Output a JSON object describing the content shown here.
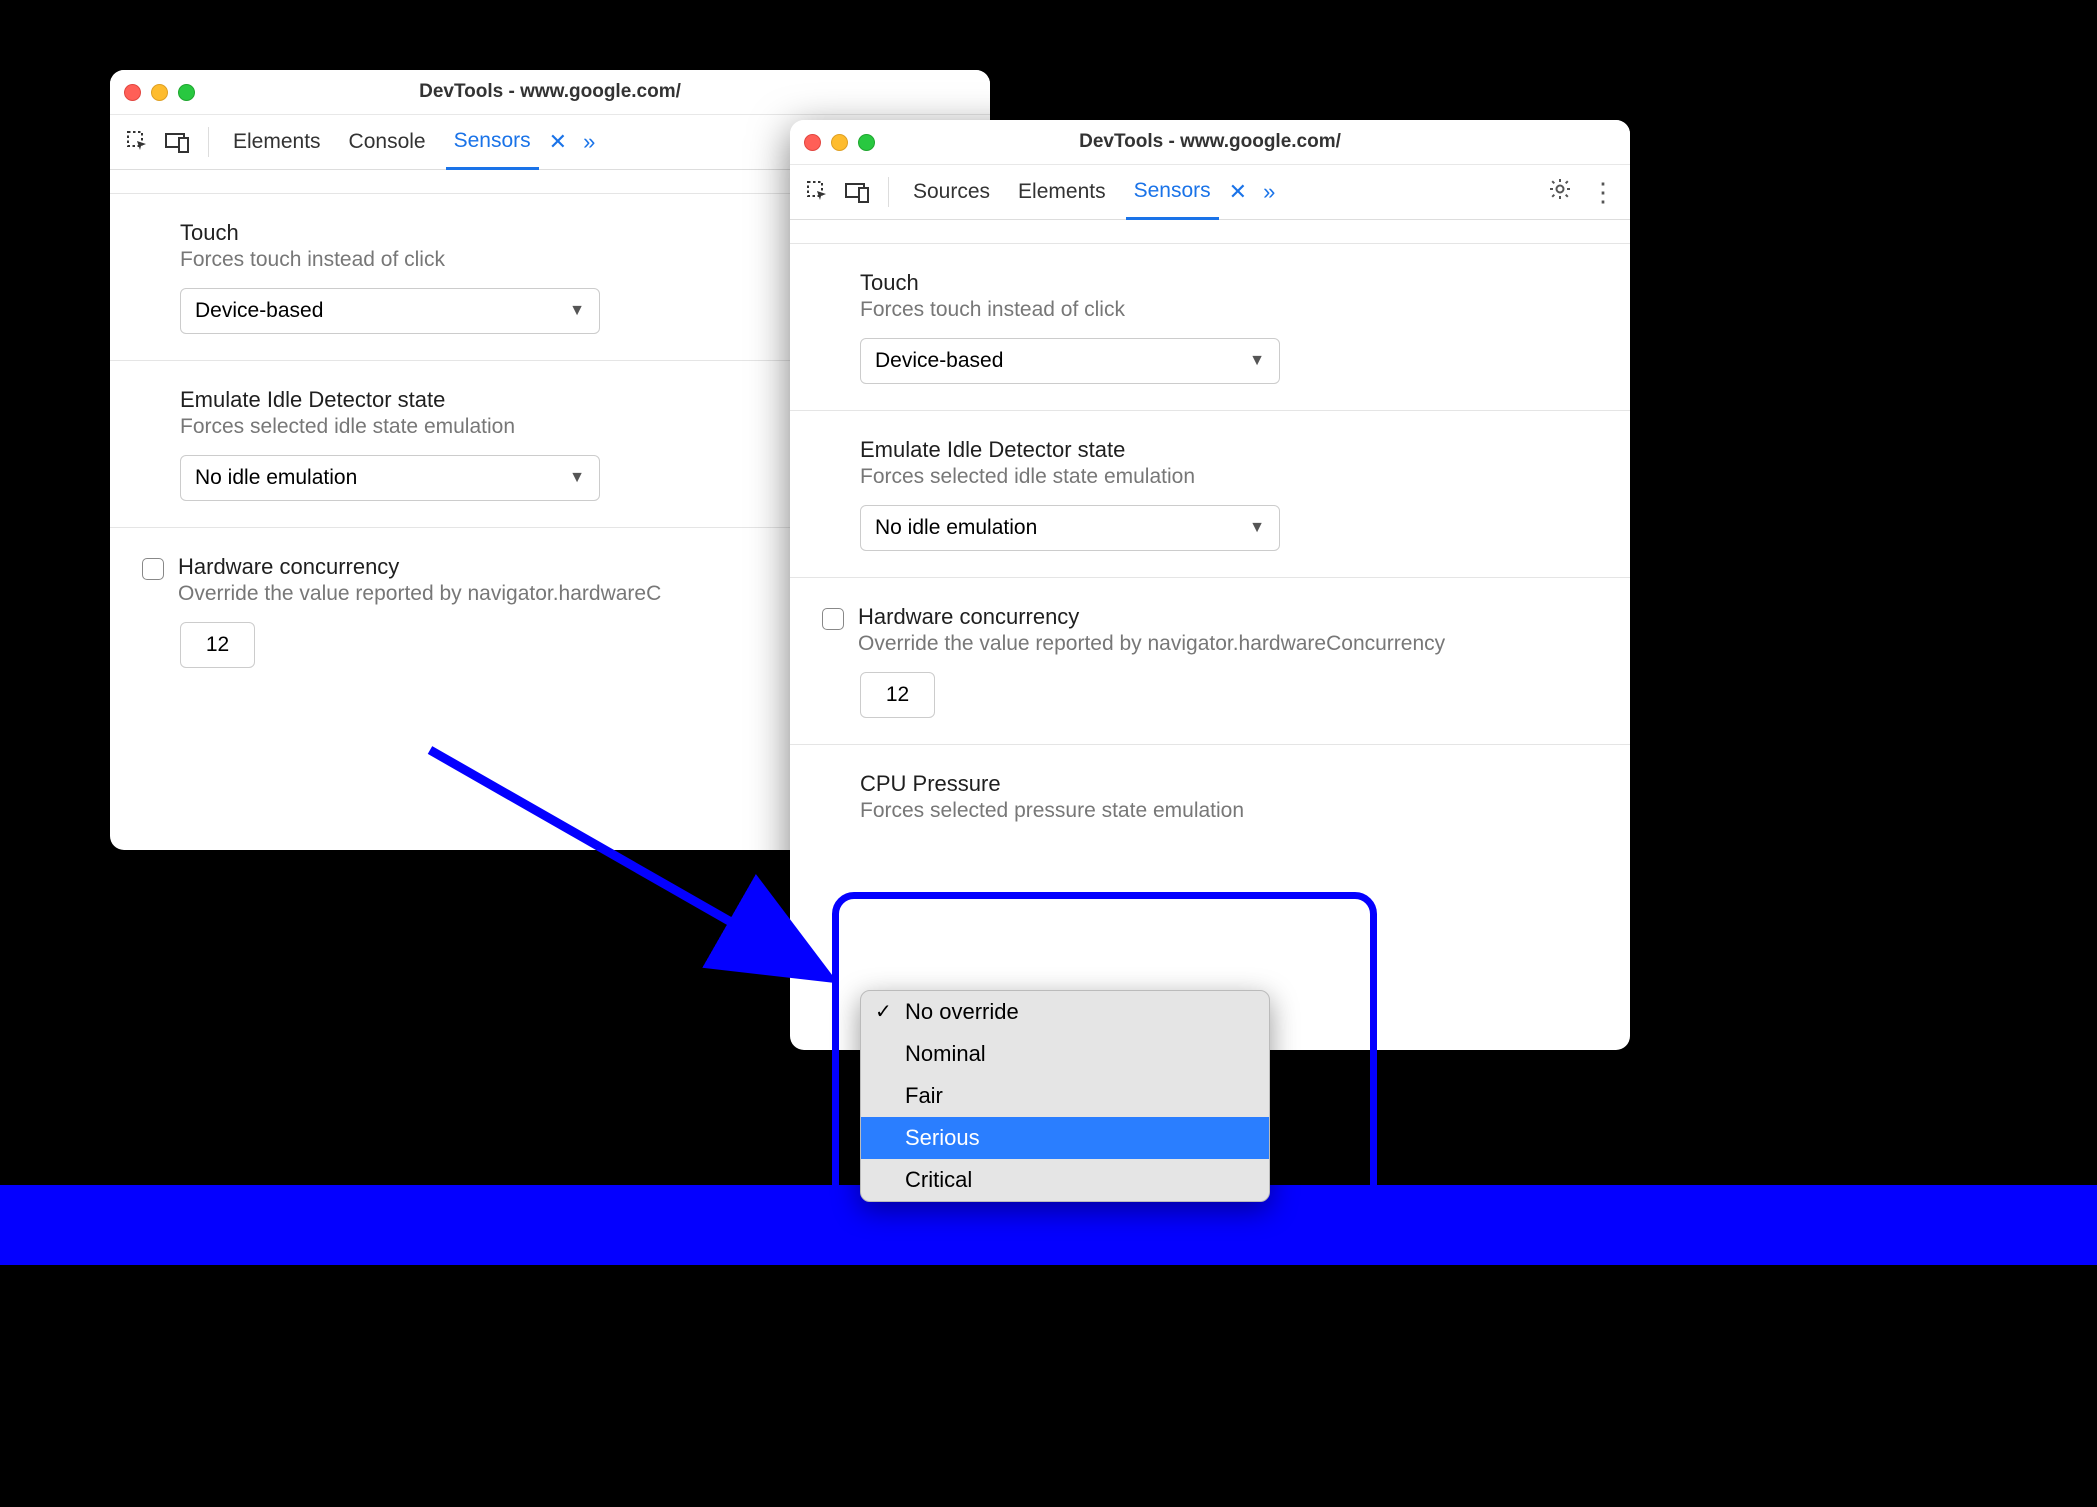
{
  "window_left": {
    "title": "DevTools - www.google.com/",
    "tabs": [
      "Elements",
      "Console",
      "Sensors"
    ],
    "active_tab": "Sensors",
    "touch": {
      "label": "Touch",
      "desc": "Forces touch instead of click",
      "value": "Device-based"
    },
    "idle": {
      "label": "Emulate Idle Detector state",
      "desc": "Forces selected idle state emulation",
      "value": "No idle emulation"
    },
    "hw": {
      "label": "Hardware concurrency",
      "desc": "Override the value reported by navigator.hardwareC",
      "value": "12"
    }
  },
  "window_right": {
    "title": "DevTools - www.google.com/",
    "tabs": [
      "Sources",
      "Elements",
      "Sensors"
    ],
    "active_tab": "Sensors",
    "touch": {
      "label": "Touch",
      "desc": "Forces touch instead of click",
      "value": "Device-based"
    },
    "idle": {
      "label": "Emulate Idle Detector state",
      "desc": "Forces selected idle state emulation",
      "value": "No idle emulation"
    },
    "hw": {
      "label": "Hardware concurrency",
      "desc": "Override the value reported by navigator.hardwareConcurrency",
      "value": "12"
    },
    "pressure": {
      "label": "CPU Pressure",
      "desc": "Forces selected pressure state emulation",
      "options": [
        "No override",
        "Nominal",
        "Fair",
        "Serious",
        "Critical"
      ],
      "selected": "No override",
      "highlighted": "Serious"
    }
  }
}
